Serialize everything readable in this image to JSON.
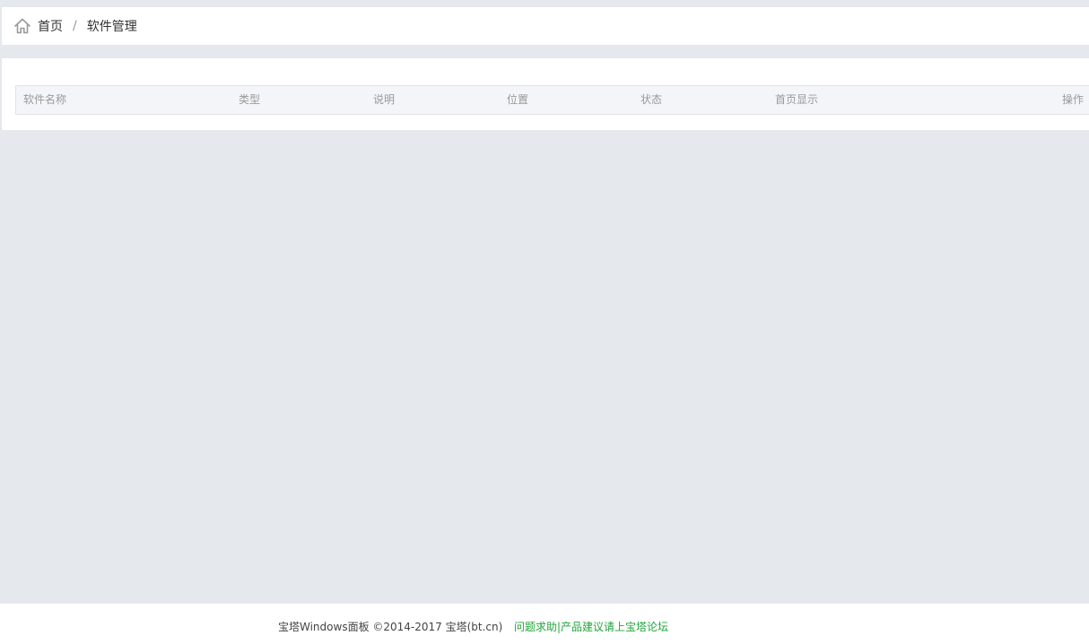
{
  "breadcrumb": {
    "home_label": "首页",
    "separator": "/",
    "current_label": "软件管理",
    "home_icon": "home-icon"
  },
  "table": {
    "columns": [
      {
        "key": "name",
        "label": "软件名称"
      },
      {
        "key": "type",
        "label": "类型"
      },
      {
        "key": "description",
        "label": "说明"
      },
      {
        "key": "location",
        "label": "位置"
      },
      {
        "key": "status",
        "label": "状态"
      },
      {
        "key": "homepage_display",
        "label": "首页显示"
      },
      {
        "key": "actions",
        "label": "操作"
      }
    ],
    "rows": []
  },
  "footer": {
    "copyright": "宝塔Windows面板 ©2014-2017 宝塔(bt.cn)",
    "forum_link": "问题求助|产品建议请上宝塔论坛"
  },
  "colors": {
    "background": "#e5e8ec",
    "panel": "#ffffff",
    "table_header": "#f4f5f9",
    "link_green": "#20a53a"
  }
}
